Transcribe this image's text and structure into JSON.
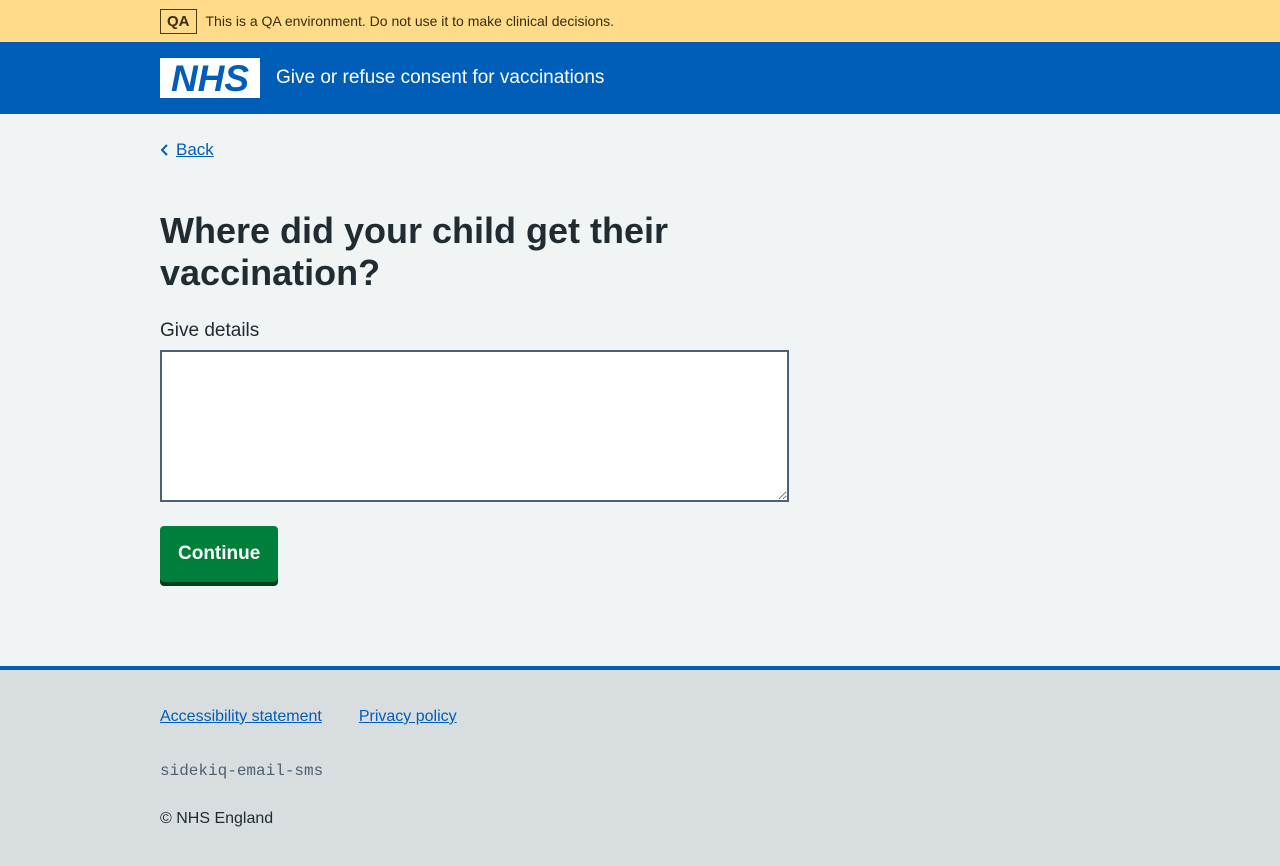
{
  "qa_banner": {
    "tag": "QA",
    "message": "This is a QA environment. Do not use it to make clinical decisions."
  },
  "header": {
    "logo_text": "NHS",
    "service_name": "Give or refuse consent for vaccinations"
  },
  "main": {
    "back_label": "Back",
    "heading": "Where did your child get their vaccination?",
    "field_label": "Give details",
    "field_value": "",
    "continue_label": "Continue"
  },
  "footer": {
    "links": [
      "Accessibility statement",
      "Privacy policy"
    ],
    "env_code": "sidekiq-email-sms",
    "copyright": "© NHS England"
  },
  "colors": {
    "banner": "#ffdb8a",
    "brand_blue": "#005eb8",
    "button_green": "#007f3b",
    "page_bg": "#f0f4f5",
    "footer_bg": "#d8dde0"
  }
}
